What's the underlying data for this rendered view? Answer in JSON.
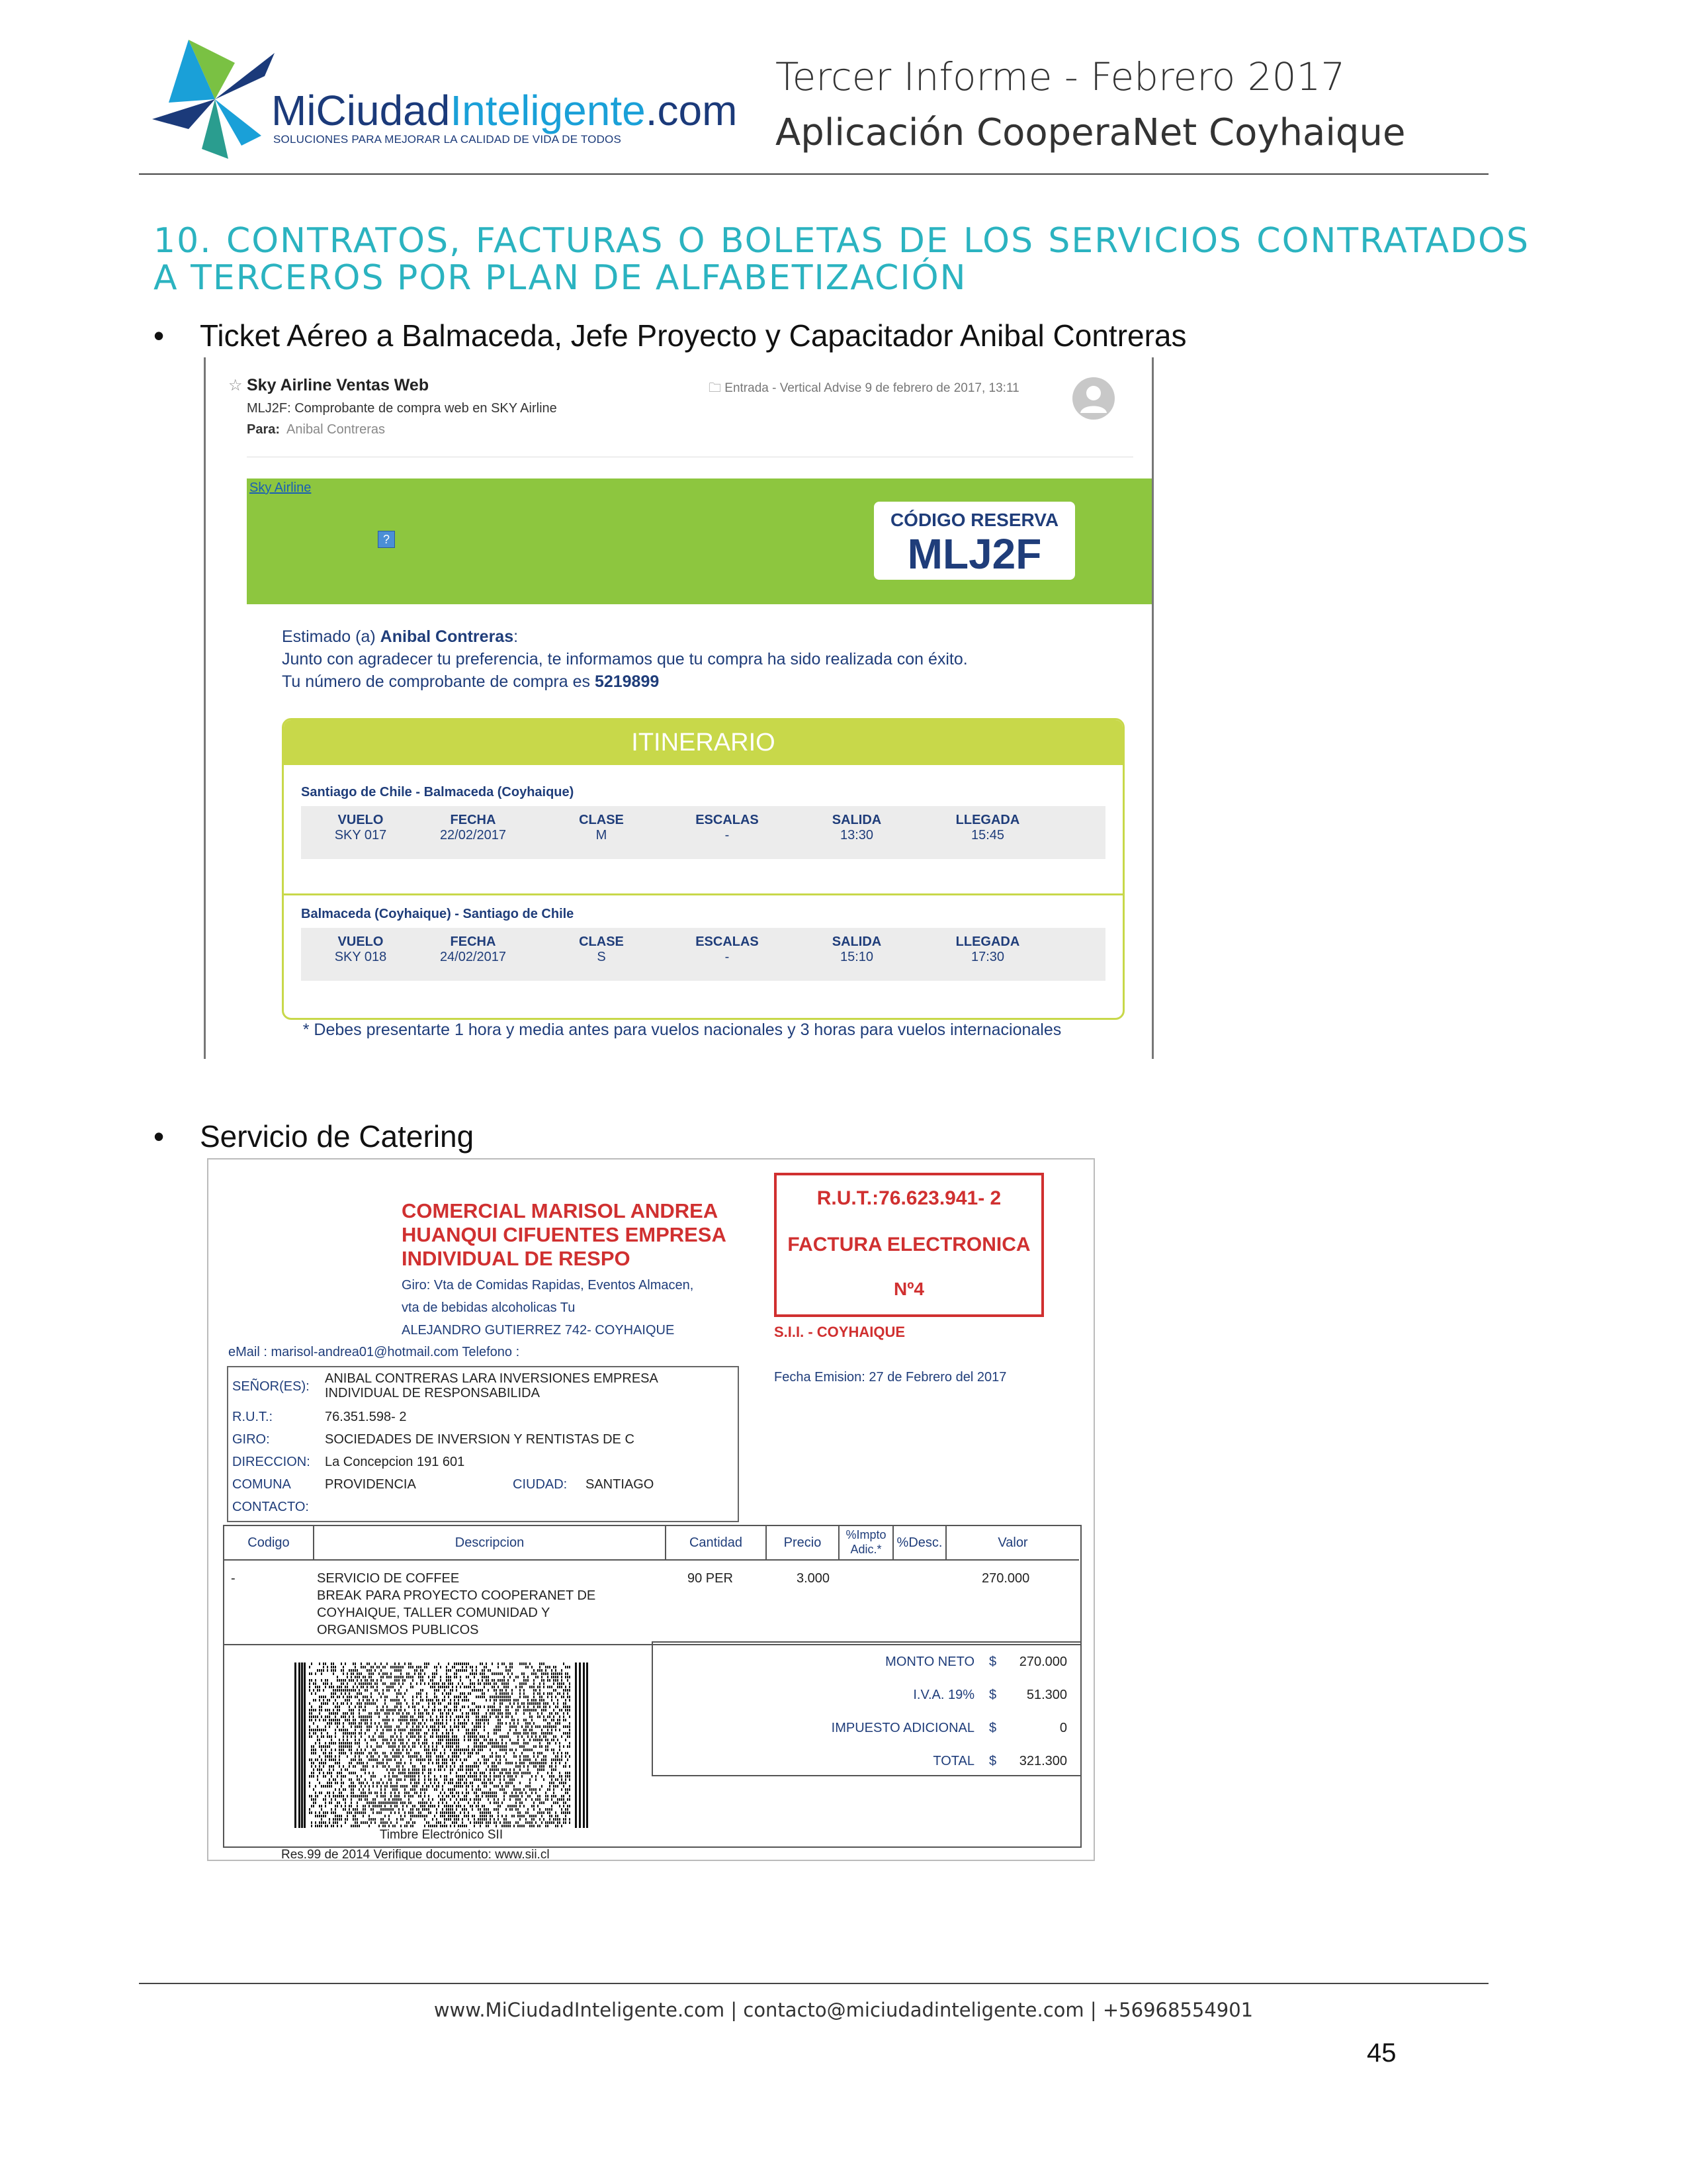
{
  "header": {
    "logo_brand_a": "MiCiudad",
    "logo_brand_b": "Inteligente",
    "logo_brand_c": ".com",
    "logo_tagline": "SOLUCIONES PARA MEJORAR LA CALIDAD DE VIDA DE TODOS",
    "title": "Tercer Informe - Febrero 2017",
    "subtitle": "Aplicación CooperaNet Coyhaique"
  },
  "section_title": "10. CONTRATOS, FACTURAS O BOLETAS DE LOS SERVICIOS CONTRATADOS A TERCEROS POR PLAN DE ALFABETIZACIÓN",
  "bullets": [
    "Ticket Aéreo a Balmaceda, Jefe Proyecto y Capacitador Anibal Contreras",
    "Servicio de Catering"
  ],
  "email": {
    "from": "Sky Airline Ventas Web",
    "subject": "MLJ2F: Comprobante de compra web en SKY Airline",
    "to_label": "Para:",
    "to_name": "Anibal Contreras",
    "folder_date": "Entrada - Vertical Advise      9 de febrero de 2017, 13:11",
    "sky_link": "Sky Airline",
    "code_label": "CÓDIGO RESERVA",
    "code_value": "MLJ2F",
    "greet_prefix": "Estimado (a) ",
    "greet_name": "Anibal Contreras",
    "greet_suffix": ":",
    "line2": "Junto con agradecer tu preferencia, te informamos que tu compra ha sido realizada con éxito.",
    "line3_prefix": "Tu número de comprobante de compra es ",
    "line3_number": "5219899",
    "itinerary_title": "ITINERARIO",
    "columns": [
      "VUELO",
      "FECHA",
      "CLASE",
      "ESCALAS",
      "SALIDA",
      "LLEGADA"
    ],
    "legs": [
      {
        "route": "Santiago de Chile - Balmaceda (Coyhaique)",
        "values": [
          "SKY 017",
          "22/02/2017",
          "M",
          "-",
          "13:30",
          "15:45"
        ]
      },
      {
        "route": "Balmaceda (Coyhaique) - Santiago de Chile",
        "values": [
          "SKY 018",
          "24/02/2017",
          "S",
          "-",
          "15:10",
          "17:30"
        ]
      }
    ],
    "note": "* Debes presentarte 1 hora y media antes para vuelos nacionales y 3 horas para vuelos internacionales"
  },
  "invoice": {
    "company": [
      "COMERCIAL MARISOL ANDREA",
      "HUANQUI CIFUENTES EMPRESA",
      "INDIVIDUAL DE RESPO"
    ],
    "giro": [
      "Giro: Vta de Comidas Rapidas, Eventos Almacen,",
      "vta de bebidas alcoholicas Tu",
      "ALEJANDRO GUTIERREZ 742- COYHAIQUE"
    ],
    "email_line": "eMail : marisol-andrea01@hotmail.com Telefono :",
    "rut": "R.U.T.:76.623.941- 2",
    "doc_type": "FACTURA ELECTRONICA",
    "doc_number": "Nº4",
    "sii": "S.I.I. - COYHAIQUE",
    "fecha": "Fecha Emision: 27 de Febrero del 2017",
    "client": {
      "senor_label": "SEÑOR(ES):",
      "senor_value": "ANIBAL CONTRERAS LARA INVERSIONES EMPRESA INDIVIDUAL DE RESPONSABILIDA",
      "rut_label": "R.U.T.:",
      "rut_value": "76.351.598- 2",
      "giro_label": "GIRO:",
      "giro_value": "SOCIEDADES DE INVERSION Y RENTISTAS DE C",
      "dir_label": "DIRECCION:",
      "dir_value": "La Concepcion 191 601",
      "comuna_label": "COMUNA",
      "comuna_value": "PROVIDENCIA",
      "ciudad_label": "CIUDAD:",
      "ciudad_value": "SANTIAGO",
      "contacto_label": "CONTACTO:"
    },
    "item_headers": [
      "Codigo",
      "Descripcion",
      "Cantidad",
      "Precio",
      "%Impto Adic.*",
      "%Desc.",
      "Valor"
    ],
    "item": {
      "codigo": "-",
      "descripcion": [
        "SERVICIO DE COFFEE",
        "BREAK PARA PROYECTO COOPERANET DE",
        "COYHAIQUE, TALLER COMUNIDAD Y",
        "ORGANISMOS PUBLICOS"
      ],
      "cantidad": "90  PER",
      "precio": "3.000",
      "valor": "270.000"
    },
    "totals": [
      {
        "label": "MONTO NETO",
        "sign": "$",
        "value": "270.000"
      },
      {
        "label": "I.V.A. 19%",
        "sign": "$",
        "value": "51.300"
      },
      {
        "label": "IMPUESTO ADICIONAL",
        "sign": "$",
        "value": "0"
      },
      {
        "label": "TOTAL",
        "sign": "$",
        "value": "321.300"
      }
    ],
    "timbre": "Timbre Electrónico SII",
    "res": "Res.99 de 2014 Verifique documento: www.sii.cl"
  },
  "footer": "www.MiCiudadInteligente.com | contacto@miciudadinteligente.com | +56968554901",
  "page_number": "45"
}
